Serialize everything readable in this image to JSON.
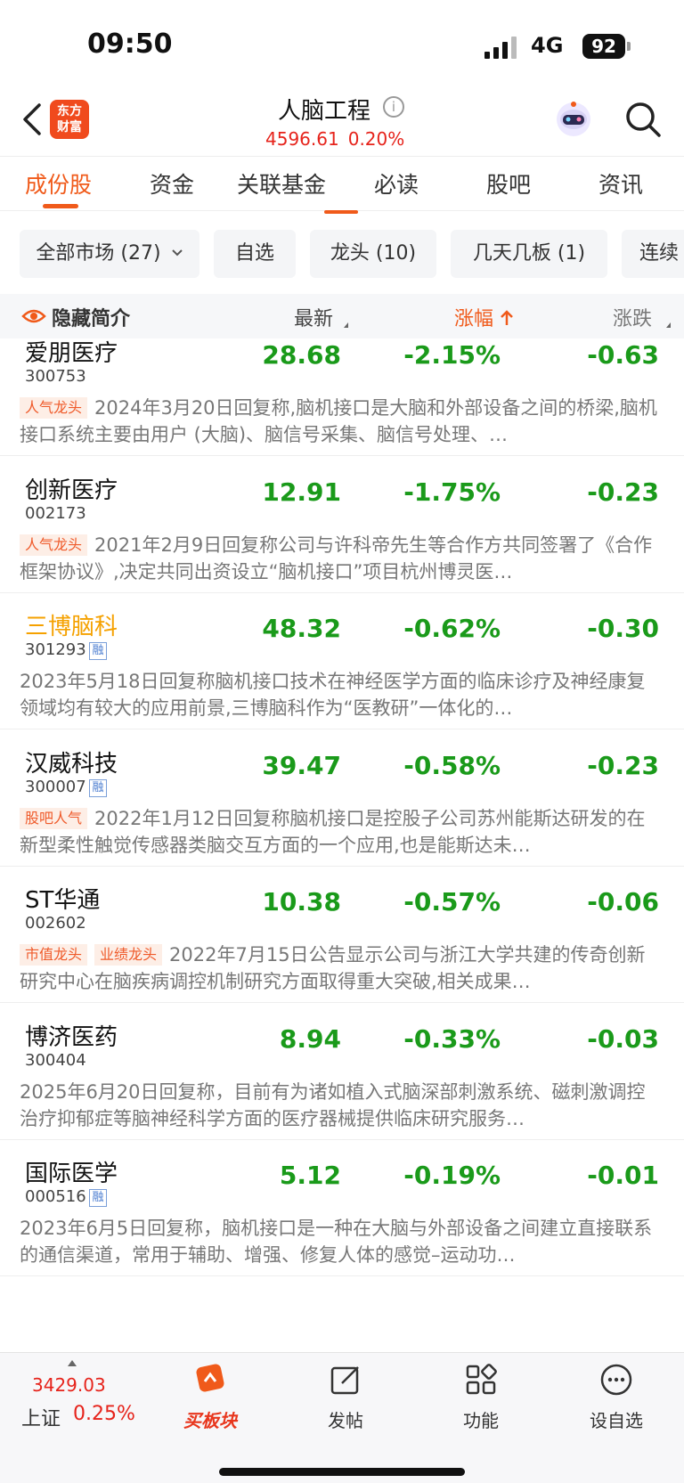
{
  "status_bar": {
    "time": "09:50",
    "network": "4G",
    "battery": "92"
  },
  "header": {
    "logo_line1": "东方",
    "logo_line2": "财富",
    "title": "人脑工程",
    "index_value": "4596.61",
    "index_change": "0.20%"
  },
  "tabs": [
    {
      "label": "成份股"
    },
    {
      "label": "资金"
    },
    {
      "label": "关联基金"
    },
    {
      "label": "必读"
    },
    {
      "label": "股吧"
    },
    {
      "label": "资讯"
    }
  ],
  "filters": [
    {
      "label": "全部市场 (27)"
    },
    {
      "label": "自选"
    },
    {
      "label": "龙头 (10)"
    },
    {
      "label": "几天几板 (1)"
    },
    {
      "label": "连续"
    }
  ],
  "columns": {
    "hide_intro": "隐藏简介",
    "latest": "最新",
    "pct": "涨幅",
    "change": "涨跌"
  },
  "stocks": [
    {
      "name": "爱朋医疗",
      "code": "300753",
      "rong": "",
      "price": "28.68",
      "pct": "-2.15%",
      "chg": "-0.63",
      "tags": [
        "人气龙头"
      ],
      "desc": "2024年3月20日回复称,脑机接口是大脑和外部设备之间的桥梁,脑机接口系统主要由用户 (大脑)、脑信号采集、脑信号处理、…"
    },
    {
      "name": "创新医疗",
      "code": "002173",
      "rong": "",
      "price": "12.91",
      "pct": "-1.75%",
      "chg": "-0.23",
      "tags": [
        "人气龙头"
      ],
      "desc": "2021年2月9日回复称公司与许科帝先生等合作方共同签署了《合作框架协议》,决定共同出资设立“脑机接口”项目杭州博灵医…"
    },
    {
      "name": "三博脑科",
      "code": "301293",
      "rong": "融",
      "price": "48.32",
      "pct": "-0.62%",
      "chg": "-0.30",
      "tags": [],
      "desc": "2023年5月18日回复称脑机接口技术在神经医学方面的临床诊疗及神经康复领域均有较大的应用前景,三博脑科作为“医教研”一体化的…"
    },
    {
      "name": "汉威科技",
      "code": "300007",
      "rong": "融",
      "price": "39.47",
      "pct": "-0.58%",
      "chg": "-0.23",
      "tags": [
        "股吧人气"
      ],
      "desc": "2022年1月12日回复称脑机接口是控股子公司苏州能斯达研发的在新型柔性触觉传感器类脑交互方面的一个应用,也是能斯达未…"
    },
    {
      "name": "ST华通",
      "code": "002602",
      "rong": "",
      "price": "10.38",
      "pct": "-0.57%",
      "chg": "-0.06",
      "tags": [
        "市值龙头",
        "业绩龙头"
      ],
      "desc": "2022年7月15日公告显示公司与浙江大学共建的传奇创新研究中心在脑疾病调控机制研究方面取得重大突破,相关成果…"
    },
    {
      "name": "博济医药",
      "code": "300404",
      "rong": "",
      "price": "8.94",
      "pct": "-0.33%",
      "chg": "-0.03",
      "tags": [],
      "desc": "2025年6月20日回复称，目前有为诸如植入式脑深部刺激系统、磁刺激调控治疗抑郁症等脑神经科学方面的医疗器械提供临床研究服务…"
    },
    {
      "name": "国际医学",
      "code": "000516",
      "rong": "融",
      "price": "5.12",
      "pct": "-0.19%",
      "chg": "-0.01",
      "tags": [],
      "desc": "2023年6月5日回复称，脑机接口是一种在大脑与外部设备之间建立直接联系的通信渠道，常用于辅助、增强、修复人体的感觉–运动功…"
    }
  ],
  "bottom_bar": {
    "index_value": "3429.03",
    "index_name": "上证",
    "index_pct": "0.25%",
    "nav": [
      {
        "label": "买板块",
        "icon": "buy-sector-icon"
      },
      {
        "label": "发帖",
        "icon": "compose-icon"
      },
      {
        "label": "功能",
        "icon": "grid-icon"
      },
      {
        "label": "设自选",
        "icon": "more-dots-icon"
      }
    ]
  },
  "colors": {
    "accent": "#f05a1a",
    "up": "#e6231b",
    "down": "#1a9a1a",
    "highlight_name": "#f5a100"
  }
}
